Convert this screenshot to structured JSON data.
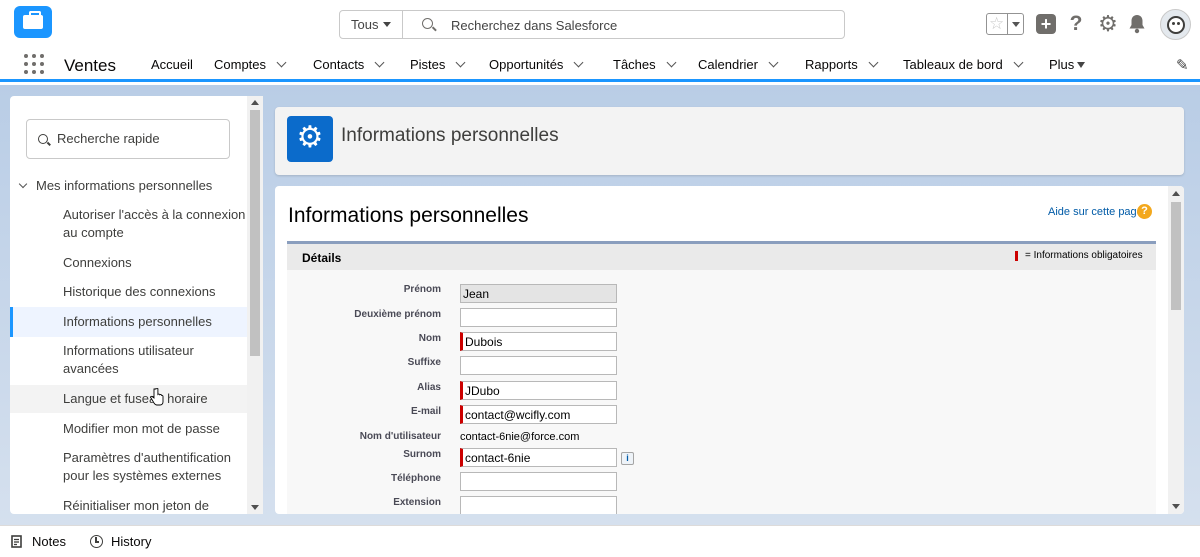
{
  "header": {
    "search_scope": "Tous",
    "search_placeholder": "Recherchez dans Salesforce"
  },
  "nav": {
    "app_name": "Ventes",
    "items": [
      {
        "label": "Accueil"
      },
      {
        "label": "Comptes"
      },
      {
        "label": "Contacts"
      },
      {
        "label": "Pistes"
      },
      {
        "label": "Opportunités"
      },
      {
        "label": "Tâches"
      },
      {
        "label": "Calendrier"
      },
      {
        "label": "Rapports"
      },
      {
        "label": "Tableaux de bord"
      },
      {
        "label": "Plus"
      }
    ]
  },
  "sidebar": {
    "quick_search_placeholder": "Recherche rapide",
    "section_label": "Mes informations personnelles",
    "items": [
      {
        "label": "Autoriser l'accès à la connexion au compte"
      },
      {
        "label": "Connexions"
      },
      {
        "label": "Historique des connexions"
      },
      {
        "label": "Informations personnelles"
      },
      {
        "label": "Informations utilisateur avancées"
      },
      {
        "label": "Langue et fuseau horaire"
      },
      {
        "label": "Modifier mon mot de passe"
      },
      {
        "label": "Paramètres d'authentification pour les systèmes externes"
      },
      {
        "label": "Réinitialiser mon jeton de"
      }
    ]
  },
  "main": {
    "header_title": "Informations personnelles",
    "page_title": "Informations personnelles",
    "help_link": "Aide sur cette page",
    "help_q": "?",
    "section_title": "Détails",
    "required_legend": "= Informations obligatoires",
    "fields": [
      {
        "label": "Prénom",
        "value": "Jean"
      },
      {
        "label": "Deuxième prénom",
        "value": ""
      },
      {
        "label": "Nom",
        "value": "Dubois"
      },
      {
        "label": "Suffixe",
        "value": ""
      },
      {
        "label": "Alias",
        "value": "JDubo"
      },
      {
        "label": "E-mail",
        "value": "contact@wcifly.com"
      },
      {
        "label": "Nom d'utilisateur",
        "value": "contact-6nie@force.com"
      },
      {
        "label": "Surnom",
        "value": "contact-6nie"
      },
      {
        "label": "Téléphone",
        "value": ""
      },
      {
        "label": "Extension",
        "value": ""
      }
    ],
    "info_glyph": "i"
  },
  "footer": {
    "notes": "Notes",
    "history": "History"
  },
  "colors": {
    "brand": "#1b96ff",
    "required": "#cc0000",
    "setup_tile": "#0b6bcb"
  }
}
